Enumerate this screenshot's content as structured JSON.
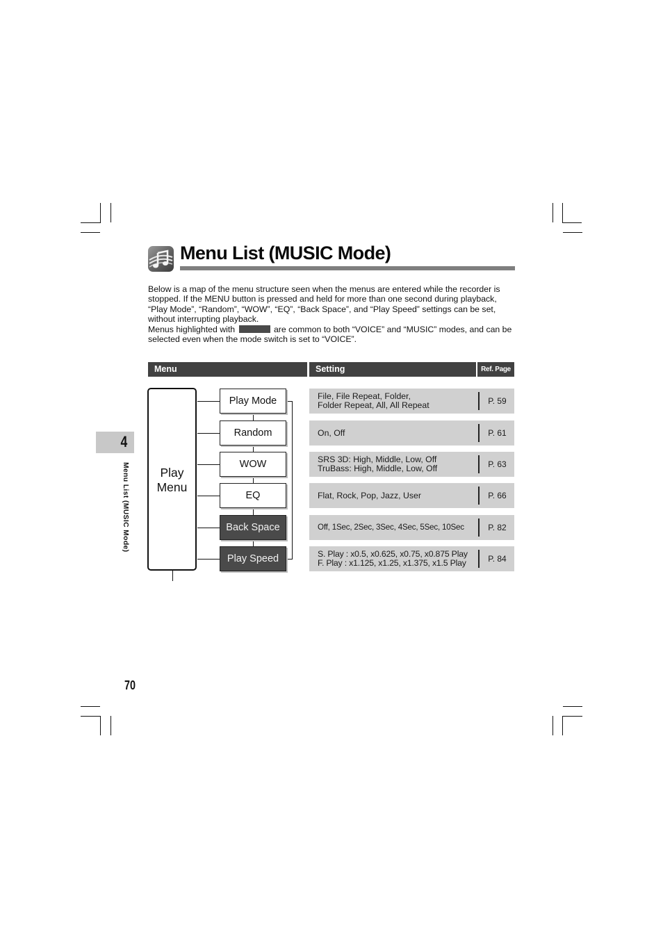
{
  "page": {
    "title": "Menu List (MUSIC Mode)",
    "title_icon": "music-note-icon",
    "page_number": "70",
    "chapter_tab": {
      "number": "4",
      "side_label": "Menu List (MUSIC Mode)"
    }
  },
  "intro": {
    "paragraph1": "Below is a map of the menu structure seen when the menus are entered while the recorder is stopped.  If the MENU button is pressed and held for more than one second during playback, “Play Mode”, “Random”, “WOW”, “EQ”, “Back Space”, and “Play Speed” settings can be set, without interrupting playback.",
    "paragraph2_before": "Menus highlighted with",
    "paragraph2_after": "are common to both “VOICE” and “MUSIC” modes, and can be selected even when the mode switch is set to “VOICE”.",
    "highlight_color": "#4a4a4a"
  },
  "table": {
    "headers": {
      "menu": "Menu",
      "setting": "Setting",
      "ref": "Ref. Page"
    },
    "root_menu": {
      "line1": "Play",
      "line2": "Menu"
    },
    "rows": [
      {
        "menu": "Play Mode",
        "common": false,
        "setting_lines": [
          "File, File Repeat, Folder,",
          "Folder Repeat, All, All Repeat"
        ],
        "ref": "P. 59"
      },
      {
        "menu": "Random",
        "common": false,
        "setting_lines": [
          "On, Off"
        ],
        "ref": "P. 61"
      },
      {
        "menu": "WOW",
        "common": false,
        "setting_lines": [
          "SRS 3D: High, Middle, Low, Off",
          "TruBass: High, Middle, Low, Off"
        ],
        "ref": "P. 63"
      },
      {
        "menu": "EQ",
        "common": false,
        "setting_lines": [
          "Flat, Rock, Pop, Jazz, User"
        ],
        "ref": "P. 66"
      },
      {
        "menu": "Back Space",
        "common": true,
        "setting_lines": [
          "Off, 1Sec, 2Sec, 3Sec, 4Sec, 5Sec, 10Sec"
        ],
        "ref": "P. 82"
      },
      {
        "menu": "Play Speed",
        "common": true,
        "setting_lines": [
          "S. Play : x0.5, x0.625, x0.75, x0.875 Play",
          "F. Play : x1.125, x1.25, x1.375, x1.5 Play"
        ],
        "ref": "P. 84"
      }
    ]
  },
  "colors": {
    "header_bg": "#414141",
    "setting_bg": "#d0d0d0",
    "common_menu_bg": "#4a4a4a",
    "title_rule": "#7f7f7f",
    "tab_bg": "#c8c8c8"
  }
}
